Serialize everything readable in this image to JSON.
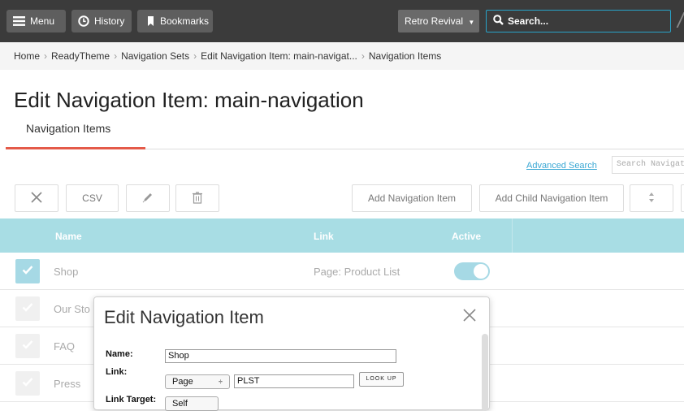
{
  "topbar": {
    "menu_label": "Menu",
    "history_label": "History",
    "bookmarks_label": "Bookmarks",
    "store_select": "Retro Revival",
    "search_placeholder": "Search...",
    "accent": "#28a3c9"
  },
  "breadcrumb": {
    "items": [
      "Home",
      "ReadyTheme",
      "Navigation Sets",
      "Edit Navigation Item: main-navigat...",
      "Navigation Items"
    ]
  },
  "page": {
    "title": "Edit Navigation Item: main-navigation",
    "tab_label": "Navigation Items",
    "tab_color": "#e45a49"
  },
  "actions": {
    "advanced_search": "Advanced Search",
    "search_grid_placeholder": "Search Navigatio",
    "csv_label": "CSV",
    "add_item_label": "Add Navigation Item",
    "add_child_label": "Add Child Navigation Item"
  },
  "table": {
    "columns": [
      "Name",
      "Link",
      "Active"
    ],
    "header_color": "#a8dde4",
    "rows": [
      {
        "name": "Shop",
        "link": "Page: Product List",
        "checked": true,
        "active": true
      },
      {
        "name": "Our Sto",
        "link": "",
        "checked": false,
        "active": false
      },
      {
        "name": "FAQ",
        "link": "",
        "checked": false,
        "active": false
      },
      {
        "name": "Press",
        "link": "",
        "checked": false,
        "active": false
      }
    ]
  },
  "modal": {
    "title": "Edit Navigation Item",
    "name_label": "Name:",
    "name_value": "Shop",
    "link_label": "Link:",
    "link_type": "Page",
    "link_value": "PLST",
    "lookup_label": "LOOK UP",
    "target_label": "Link Target:",
    "target_value": "Self"
  }
}
